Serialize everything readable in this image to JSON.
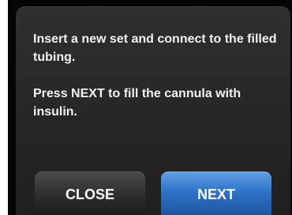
{
  "dialog": {
    "message_line1": "Insert a new set and connect to the filled tubing.",
    "message_line2": "Press NEXT to fill the cannula with insulin."
  },
  "buttons": {
    "close_label": "CLOSE",
    "next_label": "NEXT"
  },
  "colors": {
    "screen_background": "#262626",
    "text": "#f2f2f2",
    "close_button": "#2b2b2b",
    "next_button": "#2f74c7"
  }
}
